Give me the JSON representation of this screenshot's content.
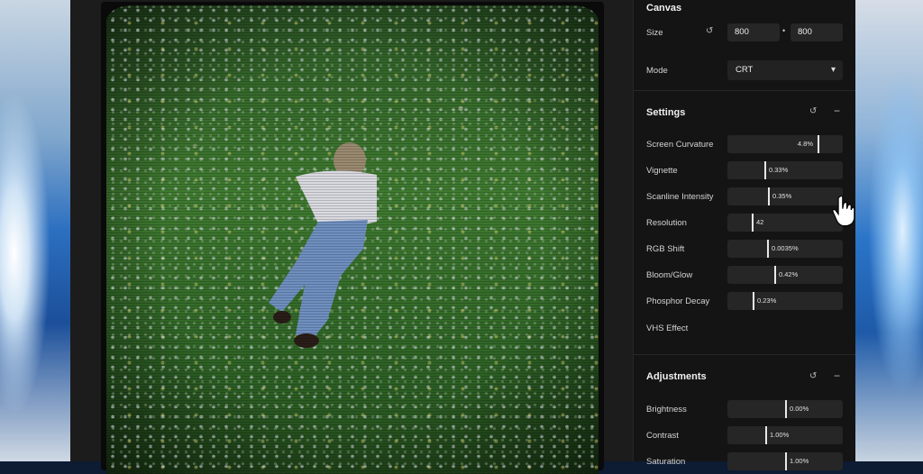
{
  "panel": {
    "canvas": {
      "title": "Canvas",
      "size_label": "Size",
      "width": "800",
      "height": "800",
      "separator": "•",
      "mode_label": "Mode",
      "mode_value": "CRT"
    },
    "settings": {
      "title": "Settings",
      "items": [
        {
          "label": "Screen Curvature",
          "value": "4.8%",
          "level": 0.78
        },
        {
          "label": "Vignette",
          "value": "0.33%",
          "level": 0.32
        },
        {
          "label": "Scanline Intensity",
          "value": "0.35%",
          "level": 0.35
        },
        {
          "label": "Resolution",
          "value": "42",
          "level": 0.21
        },
        {
          "label": "RGB Shift",
          "value": "0.0035%",
          "level": 0.34
        },
        {
          "label": "Bloom/Glow",
          "value": "0.42%",
          "level": 0.41
        },
        {
          "label": "Phosphor Decay",
          "value": "0.23%",
          "level": 0.22
        }
      ],
      "vhs_label": "VHS Effect"
    },
    "adjustments": {
      "title": "Adjustments",
      "items": [
        {
          "label": "Brightness",
          "value": "0.00%",
          "level": 0.5
        },
        {
          "label": "Contrast",
          "value": "1.00%",
          "level": 0.33
        },
        {
          "label": "Saturation",
          "value": "1.00%",
          "level": 0.5
        }
      ]
    }
  },
  "colors": {
    "panel_bg": "#141414",
    "slider_bg": "#262626",
    "accent": "#e8e8e8"
  },
  "icons": [
    "reset-icon",
    "chevron-down-icon",
    "minus-icon",
    "hand-cursor-icon"
  ]
}
